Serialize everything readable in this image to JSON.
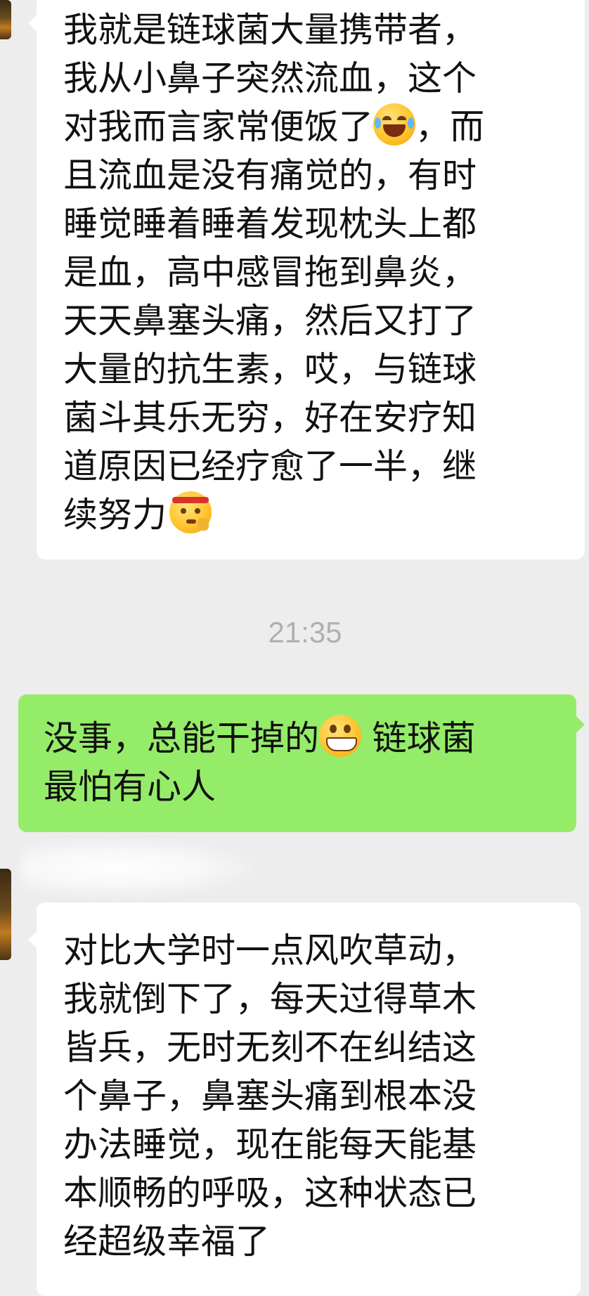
{
  "messages": [
    {
      "direction": "incoming",
      "text_before_emoji_1": "我就是链球菌大量携带者，\n我从小鼻子突然流血，这个\n对我而言家常便饭了",
      "emoji_1": "tears-of-joy-emoji",
      "text_after_emoji_1": "，而\n且流血是没有痛觉的，有时\n睡觉睡着睡着发现枕头上都\n是血，高中感冒拖到鼻炎，\n天天鼻塞头痛，然后又打了\n大量的抗生素，哎，与链球\n菌斗其乐无穷，好在安疗知\n道原因已经疗愈了一半，继\n续努力",
      "emoji_2": "determined-headband-emoji"
    },
    {
      "direction": "timestamp",
      "text": "21:35"
    },
    {
      "direction": "outgoing",
      "text_before_emoji": "没事，总能干掉的",
      "emoji": "grinning-emoji",
      "text_after_emoji": " 链球菌\n最怕有心人"
    },
    {
      "direction": "incoming",
      "text": "对比大学时一点风吹草动，\n我就倒下了，每天过得草木\n皆兵，无时无刻不在纠结这\n个鼻子，鼻塞头痛到根本没\n办法睡觉，现在能每天能基\n本顺畅的呼吸，这种状态已\n经超级幸福了"
    }
  ],
  "colors": {
    "background": "#ededed",
    "incoming_bubble": "#ffffff",
    "outgoing_bubble": "#95ec69",
    "timestamp_text": "#b0b0b0",
    "message_text": "#111111"
  }
}
